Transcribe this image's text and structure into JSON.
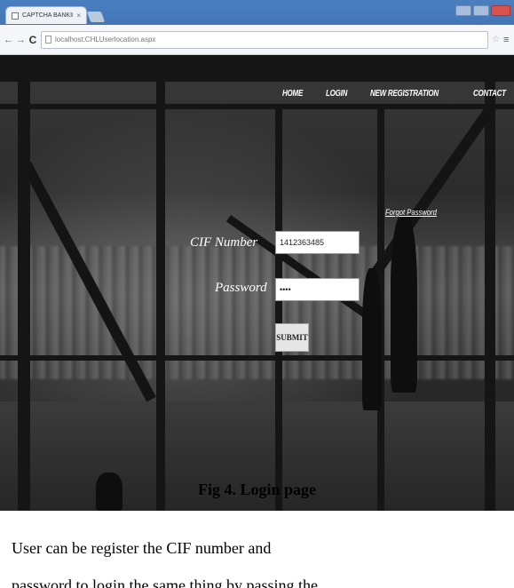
{
  "browser": {
    "tab_title": "CAPTCHA BANKING",
    "tab_close": "×",
    "back": "←",
    "forward": "→",
    "reload": "C",
    "url": "localhost:CHLUserlocation.aspx",
    "star": "☆",
    "menu": "≡"
  },
  "nav": {
    "items": [
      "HOME",
      "LOGIN",
      "NEW REGISTRATION",
      "CONTACT"
    ]
  },
  "login": {
    "forgot_password": "Forgot Password",
    "cif_label": "CIF Number",
    "cif_value": "1412363485",
    "password_label": "Password",
    "password_value": "••••",
    "submit_label": "SUBMIT"
  },
  "document": {
    "caption": "Fig 4. Login page",
    "paragraph_line1": "User can be register the CIF number and",
    "paragraph_line2": "password to login the same thing by passing the"
  }
}
